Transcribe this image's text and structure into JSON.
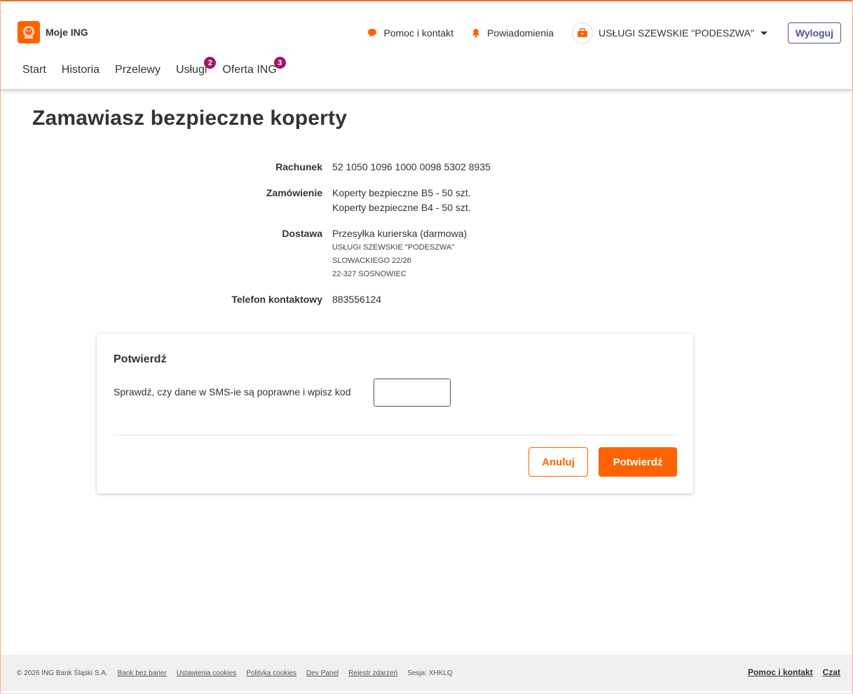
{
  "header": {
    "brand": "Moje ING",
    "help": "Pomoc i kontakt",
    "notifications": "Powiadomienia",
    "company": "USŁUGI SZEWSKIE \"PODESZWA\"",
    "logout": "Wyloguj",
    "accent": "#ff6200"
  },
  "nav": {
    "items": [
      {
        "label": "Start"
      },
      {
        "label": "Historia"
      },
      {
        "label": "Przelewy"
      },
      {
        "label": "Usługi",
        "badge": "2"
      },
      {
        "label": "Oferta ING",
        "badge": "3"
      }
    ]
  },
  "main": {
    "title": "Zamawiasz bezpieczne koperty",
    "details": {
      "account_label": "Rachunek",
      "account_value": "52 1050 1096 1000 0098 5302 8935",
      "order_label": "Zamówienie",
      "order_line1": "Koperty bezpieczne B5 - 50 szt.",
      "order_line2": "Koperty bezpieczne B4 - 50 szt.",
      "delivery_label": "Dostawa",
      "delivery_method": "Przesyłka kurierska (darmowa)",
      "delivery_name": "USŁUGI SZEWSKIE \"PODESZWA\"",
      "delivery_street": "SLOWACKIEGO 22/26",
      "delivery_city": "22-327 SOSNOWIEC",
      "phone_label": "Telefon kontaktowy",
      "phone_value": "883556124"
    },
    "confirm": {
      "title": "Potwierdź",
      "instruction": "Sprawdź, czy dane w SMS-ie są poprawne i wpisz kod",
      "code_value": "",
      "cancel": "Anuluj",
      "submit": "Potwierdź"
    }
  },
  "footer": {
    "copyright": "© 2026 ING Bank Śląski S.A.",
    "links": [
      "Bank bez barier",
      "Ustawienia cookies",
      "Polityka cookies",
      "Dev Panel",
      "Rejestr zdarzeń"
    ],
    "session": "Sesja: XHKLQ",
    "help": "Pomoc i kontakt",
    "chat": "Czat"
  }
}
